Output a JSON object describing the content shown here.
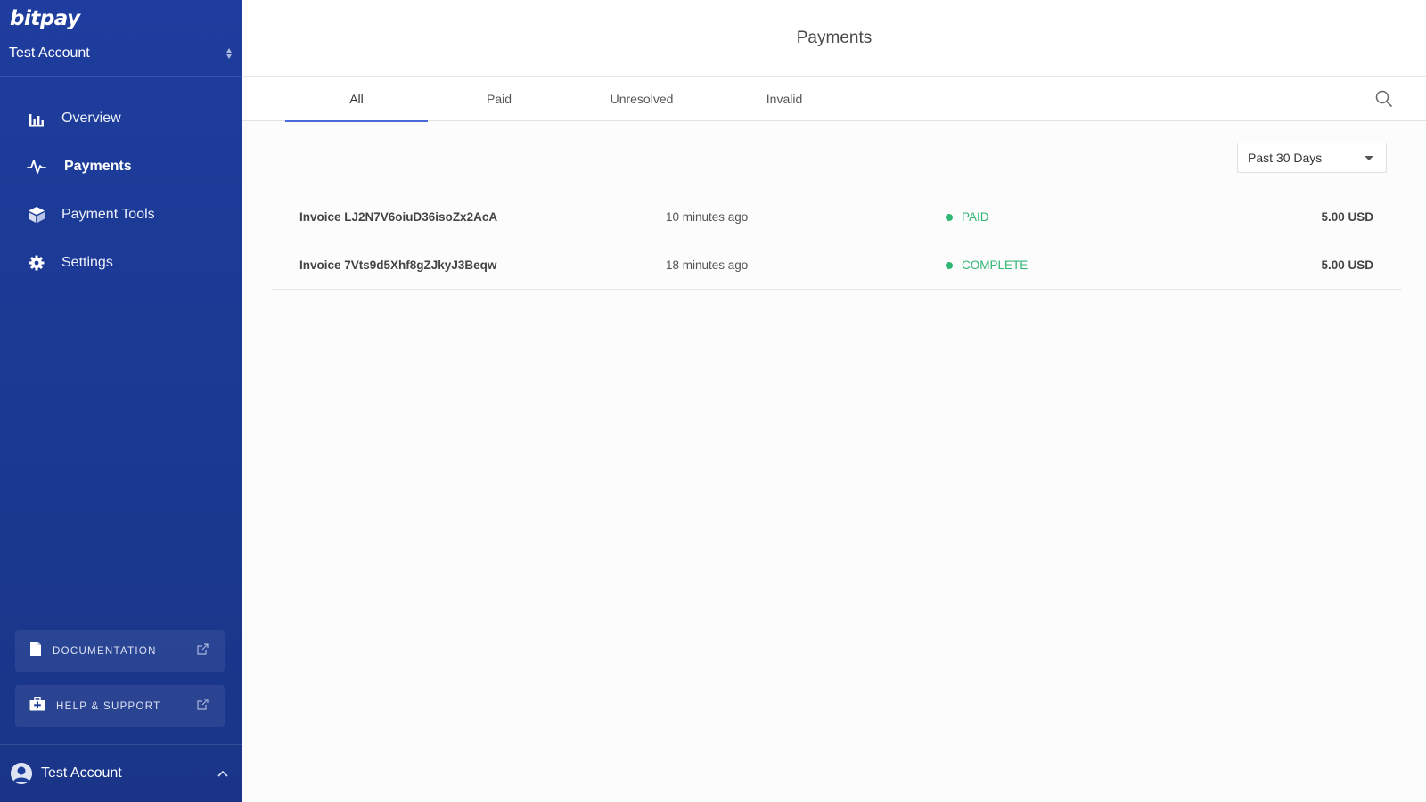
{
  "sidebar": {
    "logo": "bitpay",
    "account_switcher": "Test Account",
    "nav": [
      {
        "label": "Overview",
        "icon": "bar-chart-icon"
      },
      {
        "label": "Payments",
        "icon": "activity-pulse-icon",
        "active": true
      },
      {
        "label": "Payment Tools",
        "icon": "cube-icon"
      },
      {
        "label": "Settings",
        "icon": "gear-icon"
      }
    ],
    "documentation_label": "DOCUMENTATION",
    "help_label": "HELP & SUPPORT",
    "user_name": "Test Account"
  },
  "header": {
    "title": "Payments"
  },
  "tabs": [
    {
      "label": "All",
      "active": true
    },
    {
      "label": "Paid"
    },
    {
      "label": "Unresolved"
    },
    {
      "label": "Invalid"
    }
  ],
  "filter": {
    "selected": "Past 30 Days"
  },
  "payments": [
    {
      "invoice": "Invoice LJ2N7V6oiuD36isoZx2AcA",
      "time": "10 minutes ago",
      "status": "PAID",
      "amount": "5.00 USD"
    },
    {
      "invoice": "Invoice 7Vts9d5Xhf8gZJkyJ3Beqw",
      "time": "18 minutes ago",
      "status": "COMPLETE",
      "amount": "5.00 USD"
    }
  ],
  "colors": {
    "sidebar": "#1f3d9e",
    "accent": "#4a6bd8",
    "status_green": "#2fb673"
  }
}
